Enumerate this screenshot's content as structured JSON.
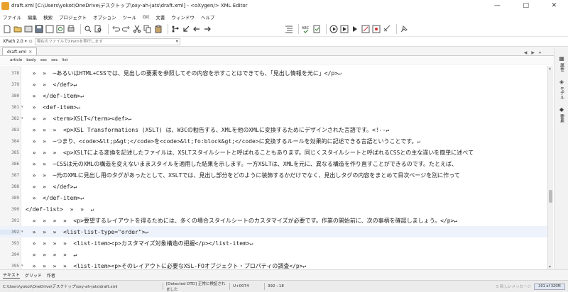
{
  "window": {
    "title": "draft.xml [C:\\Users\\yokot\\OneDrive\\デスクトップ\\oxy-ah-jats\\draft.xml] - <oXygen/> XML Editor",
    "minimize": "—",
    "maximize": "□",
    "close": "✕"
  },
  "menu": [
    "ファイル",
    "編集",
    "検索",
    "プロジェクト",
    "オプション",
    "ツール",
    "Git",
    "文書",
    "ウィンドウ",
    "ヘルプ"
  ],
  "xpath": {
    "label": "XPath 2.0",
    "caret": "▾",
    "placeholder": "現在のファイルでXPathを実行します"
  },
  "tab": {
    "label": "draft.xml",
    "close": "✕"
  },
  "tabbar_controls": [
    "◀",
    "▶",
    "▾"
  ],
  "breadcrumb": [
    "article",
    "body",
    "sec",
    "sec",
    "list"
  ],
  "editor": {
    "lines": [
      {
        "num": "378",
        "fold": "",
        "code": "  »  »  ─あるいはHTML+CSSでは、見出しの要素を参照してその内容を示すことはできても、「見出し情報を元に」</p>↵"
      },
      {
        "num": "379",
        "fold": "",
        "code": "  »  »  </def>↵"
      },
      {
        "num": "380",
        "fold": "",
        "code": "  »  </def-item>↵"
      },
      {
        "num": "381",
        "fold": "▾",
        "code": "  »  <def-item>↵"
      },
      {
        "num": "382",
        "fold": "▾",
        "code": "  »  »  <term>XSLT</term><def>↵"
      },
      {
        "num": "383",
        "fold": "",
        "code": "  »  »  »  <p>XSL Transformations (XSLT) は、W3Cの勧告する、XMLを他のXMLに変換するためにデザインされた言語です。<!--↵"
      },
      {
        "num": "384",
        "fold": "",
        "code": "  »  »  ─つまり、<code>&lt;p&gt;</code>を<code>&lt;fo:block&gt;</code>に変換するルールを効果的に記述できる言語ということです。↵"
      },
      {
        "num": "385",
        "fold": "",
        "code": "  »  »  »  <p>XSLTによる変換を記述したファイルは、XSLTスタイルシートと呼ばれることもあります。同じくスタイルシートと呼ばれるCSSとの主な違いを簡単に述べて"
      },
      {
        "num": "386",
        "fold": "",
        "code": "  »  »  ─CSSは元のXMLの構造を変えないままスタイルを適用した結果を示します。一方XSLTは、XMLを元に、異なる構造を作り直すことができるのです。たとえば、"
      },
      {
        "num": "387",
        "fold": "",
        "code": "  »  »  ─元のXMLに見出し用のタグがあったとして、XSLTでは、見出し部分をどのように装飾するかだけでなく、見出しタグの内容をまとめて目次ページを別に作って"
      },
      {
        "num": "388",
        "fold": "",
        "code": "  »  »  </def>↵"
      },
      {
        "num": "389",
        "fold": "",
        "code": "  »  </def-item>↵"
      },
      {
        "num": "390",
        "fold": "",
        "code": "</def-list>  »  »  ↵"
      },
      {
        "num": "391",
        "fold": "",
        "code": "  »  »  »  »  <p>要望するレイアウトを得るためには、多くの場合スタイルシートのカスタマイズが必要です。作業の開始前に、次の事柄を確認しましょう。</p>↵"
      },
      {
        "num": "392",
        "fold": "▾",
        "code": "  »  »  »  <list·list-type=\"order\">↵"
      },
      {
        "num": "393",
        "fold": "",
        "code": "  »  »  »  »  <list-item><p>カスタマイズ対象構造の把握</p></list-item>↵"
      },
      {
        "num": "394",
        "fold": "",
        "code": "  »  »  »  »  ↵"
      },
      {
        "num": "395",
        "fold": "▾",
        "code": "  »  »  »  »  <list-item><p>そのレイアウトに必要なXSL-FOオブジェクト・プロパティの調査</p>↵"
      },
      {
        "num": "396",
        "fold": "▾",
        "code": "  »  »  »  »  »  <list·list-type=\"bullet\">↵"
      },
      {
        "num": "397",
        "fold": "▾",
        "code": "  »  »  »  »  »  »  <list-item>↵"
      },
      {
        "num": "398",
        "fold": "",
        "code": "  »  »  »  »  »  »  »  <p>仕様に存在するか</p>↵"
      }
    ],
    "current_line": "392"
  },
  "side_panel": [
    {
      "icon": "▦",
      "label": "属性"
    },
    {
      "icon": "◈",
      "label": "モデル"
    },
    {
      "icon": "◆",
      "label": "要素"
    }
  ],
  "modes": [
    "テキスト",
    "グリッド",
    "作者"
  ],
  "active_mode": "テキスト",
  "status": {
    "path": "C:\\Users\\yokot\\OneDrive\\デスクトップ\\oxy-ah-jats\\draft.xml",
    "validation": "[Detected DTD] 正常に検証されました",
    "encoding": "U+0074",
    "position": "392 : 18",
    "message": "5 新しいメッセージ",
    "memory": "201 of 320M"
  }
}
